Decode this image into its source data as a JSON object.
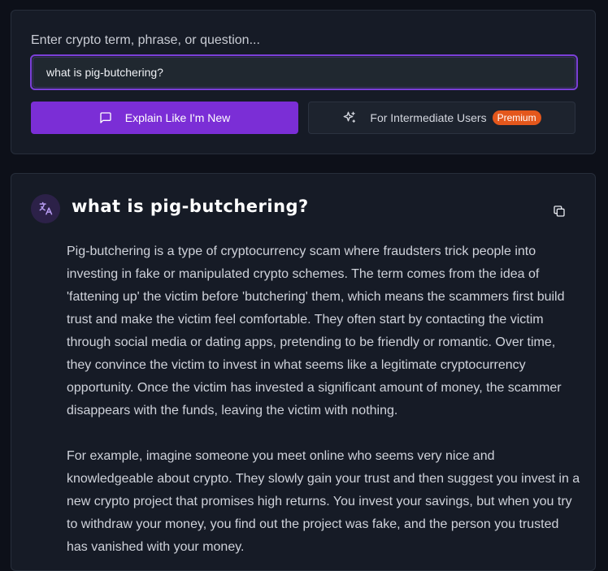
{
  "query": {
    "label": "Enter crypto term, phrase, or question...",
    "value": "what is pig-butchering?",
    "explain_new_label": "Explain Like I'm New",
    "intermediate_label": "For Intermediate Users",
    "premium_badge": "Premium"
  },
  "answer": {
    "title": "what is pig-butchering?",
    "paragraphs": [
      "Pig-butchering is a type of cryptocurrency scam where fraudsters trick people into investing in fake or manipulated crypto schemes. The term comes from the idea of 'fattening up' the victim before 'butchering' them, which means the scammers first build trust and make the victim feel comfortable. They often start by contacting the victim through social media or dating apps, pretending to be friendly or romantic. Over time, they convince the victim to invest in what seems like a legitimate cryptocurrency opportunity. Once the victim has invested a significant amount of money, the scammer disappears with the funds, leaving the victim with nothing.",
      "For example, imagine someone you meet online who seems very nice and knowledgeable about crypto. They slowly gain your trust and then suggest you invest in a new crypto project that promises high returns. You invest your savings, but when you try to withdraw your money, you find out the project was fake, and the person you trusted has vanished with your money."
    ]
  },
  "colors": {
    "accent": "#7b2ed6",
    "premium": "#e4571c",
    "background": "#0d1019",
    "panel": "#161b26"
  },
  "icons": {
    "explain_new": "message-square-icon",
    "intermediate": "sparkles-icon",
    "avatar": "translate-icon",
    "copy": "copy-icon"
  }
}
